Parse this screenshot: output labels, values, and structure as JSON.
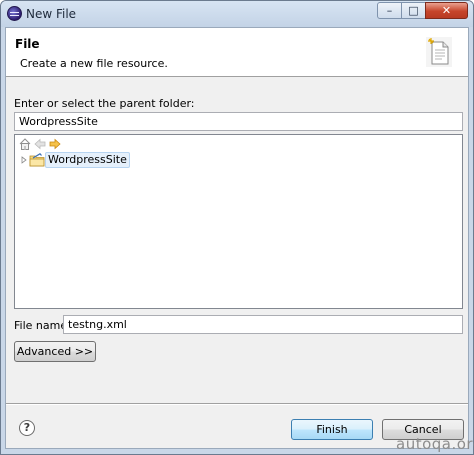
{
  "window": {
    "title": "New File",
    "app_icon": "eclipse-icon",
    "controls": {
      "minimize": "–",
      "maximize": "□",
      "close": "✕"
    }
  },
  "banner": {
    "title": "File",
    "description": "Create a new file resource.",
    "image_icon": "new-file-wizard-icon"
  },
  "parent_folder": {
    "label": "Enter or select the parent folder:",
    "value": "WordpressSite"
  },
  "tree_toolbar": {
    "icons": [
      "home-icon",
      "back-arrow-icon",
      "forward-arrow-icon"
    ]
  },
  "tree": {
    "items": [
      {
        "label": "WordpressSite",
        "icon": "project-folder-icon",
        "expander": "collapsed",
        "selected": true
      }
    ]
  },
  "file_name": {
    "label": "File name:",
    "value": "testng.xml"
  },
  "buttons": {
    "advanced": "Advanced >>",
    "help": "?",
    "finish": "Finish",
    "cancel": "Cancel"
  },
  "watermark": "autoqa.org",
  "colors": {
    "default_button_border": "#3c7fb1",
    "selection_background": "#e5f0fb",
    "forward_arrow": "#e8a317"
  }
}
